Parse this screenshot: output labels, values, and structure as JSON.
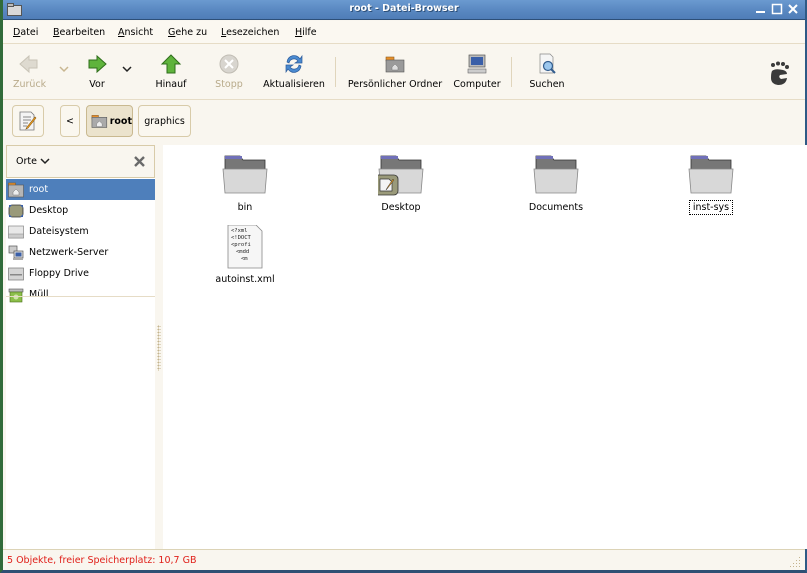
{
  "window": {
    "title": "root - Datei-Browser",
    "controls": {
      "minimize": "minimize",
      "maximize": "maximize",
      "close": "close"
    }
  },
  "menubar": {
    "items": [
      {
        "label": "Datei",
        "mnemonic": "D"
      },
      {
        "label": "Bearbeiten",
        "mnemonic": "B"
      },
      {
        "label": "Ansicht",
        "mnemonic": "A"
      },
      {
        "label": "Gehe zu",
        "mnemonic": "G"
      },
      {
        "label": "Lesezeichen",
        "mnemonic": "L"
      },
      {
        "label": "Hilfe",
        "mnemonic": "H"
      }
    ]
  },
  "toolbar": {
    "back": {
      "label": "Zurück",
      "icon": "arrow-left-icon",
      "enabled": false
    },
    "forward": {
      "label": "Vor",
      "icon": "arrow-right-icon",
      "enabled": true
    },
    "up": {
      "label": "Hinauf",
      "icon": "arrow-up-icon",
      "enabled": true
    },
    "stop": {
      "label": "Stopp",
      "icon": "stop-icon",
      "enabled": false
    },
    "reload": {
      "label": "Aktualisieren",
      "icon": "reload-icon",
      "enabled": true
    },
    "home": {
      "label": "Persönlicher Ordner",
      "icon": "home-folder-icon",
      "enabled": true
    },
    "computer": {
      "label": "Computer",
      "icon": "computer-icon",
      "enabled": true
    },
    "search": {
      "label": "Suchen",
      "icon": "search-icon",
      "enabled": true
    },
    "logo": "gnome-foot-icon"
  },
  "pathbar": {
    "edit_toggle_icon": "edit-location-icon",
    "scroll_left": "<",
    "crumbs": [
      {
        "label": "root",
        "active": true,
        "icon": "home-folder-icon"
      },
      {
        "label": "graphics",
        "active": false
      }
    ]
  },
  "sidebar": {
    "header": {
      "label": "Orte",
      "close_icon": "close-icon"
    },
    "items": [
      {
        "label": "root",
        "icon": "home-folder-icon",
        "selected": true
      },
      {
        "label": "Desktop",
        "icon": "desktop-icon",
        "selected": false
      },
      {
        "label": "Dateisystem",
        "icon": "harddisk-icon",
        "selected": false
      },
      {
        "label": "Netzwerk-Server",
        "icon": "network-icon",
        "selected": false
      },
      {
        "label": "Floppy Drive",
        "icon": "floppy-icon",
        "selected": false
      },
      {
        "label": "Müll",
        "icon": "trash-icon",
        "selected": false
      }
    ]
  },
  "files": [
    {
      "name": "bin",
      "type": "folder",
      "focused": false
    },
    {
      "name": "Desktop",
      "type": "folder",
      "emblem": "desktop-emblem",
      "focused": false
    },
    {
      "name": "Documents",
      "type": "folder",
      "focused": false
    },
    {
      "name": "inst-sys",
      "type": "folder",
      "focused": true
    },
    {
      "name": "autoinst.xml",
      "type": "xml",
      "preview": [
        "<?xml",
        "<!DOCT",
        "<profi",
        "<mdd",
        "<m"
      ],
      "focused": false
    }
  ],
  "statusbar": {
    "text": "5 Objekte, freier Speicherplatz: 10,7 GB"
  },
  "colors": {
    "titlebar": "#5a89c2",
    "selection": "#4e7fbb",
    "status_text": "#e0201a",
    "background": "#f9f6ef"
  }
}
